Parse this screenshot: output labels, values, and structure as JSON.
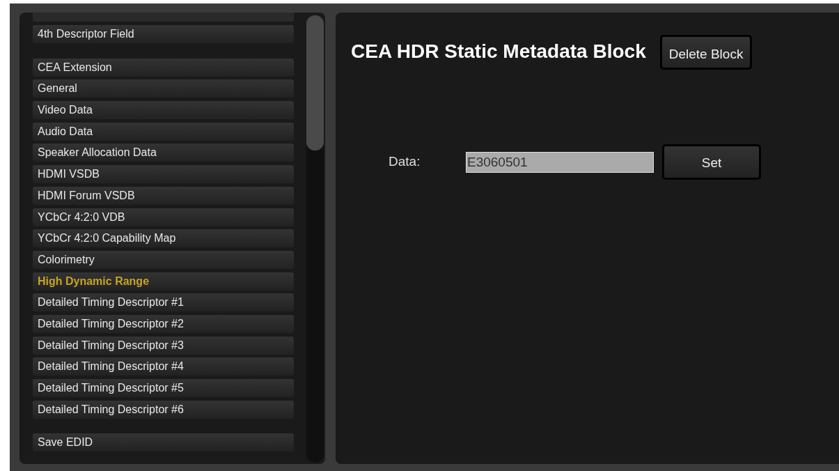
{
  "sidebar": {
    "groups": [
      {
        "items": [
          {
            "label": "4th Descriptor Field",
            "selected": false
          }
        ]
      },
      {
        "items": [
          {
            "label": "CEA Extension",
            "selected": false
          },
          {
            "label": "General",
            "selected": false
          },
          {
            "label": "Video Data",
            "selected": false
          },
          {
            "label": "Audio Data",
            "selected": false
          },
          {
            "label": "Speaker Allocation Data",
            "selected": false
          },
          {
            "label": "HDMI VSDB",
            "selected": false
          },
          {
            "label": "HDMI Forum VSDB",
            "selected": false
          },
          {
            "label": "YCbCr 4:2:0 VDB",
            "selected": false
          },
          {
            "label": "YCbCr 4:2:0 Capability Map",
            "selected": false
          },
          {
            "label": "Colorimetry",
            "selected": false
          },
          {
            "label": "High Dynamic Range",
            "selected": true
          },
          {
            "label": "Detailed Timing Descriptor #1",
            "selected": false
          },
          {
            "label": "Detailed Timing Descriptor #2",
            "selected": false
          },
          {
            "label": "Detailed Timing Descriptor #3",
            "selected": false
          },
          {
            "label": "Detailed Timing Descriptor #4",
            "selected": false
          },
          {
            "label": "Detailed Timing Descriptor #5",
            "selected": false
          },
          {
            "label": "Detailed Timing Descriptor #6",
            "selected": false
          }
        ]
      },
      {
        "items": [
          {
            "label": "Save EDID",
            "selected": false
          }
        ]
      }
    ]
  },
  "panel": {
    "title": "CEA HDR Static Metadata Block",
    "delete_button": "Delete Block",
    "field_label": "Data:",
    "field_value": "E3060501",
    "set_button": "Set"
  }
}
